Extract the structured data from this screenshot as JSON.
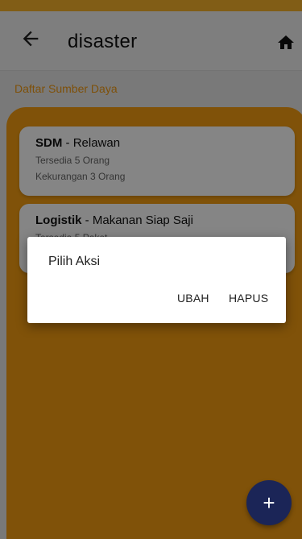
{
  "appbar": {
    "title": "disaster",
    "back_icon": "arrow-left-icon",
    "home_icon": "home-icon"
  },
  "section": {
    "title": "Daftar Sumber Daya"
  },
  "cards": [
    {
      "category": "SDM",
      "separator": " - ",
      "name": "Relawan",
      "line1": "Tersedia 5 Orang",
      "line2": "Kekurangan 3 Orang"
    },
    {
      "category": "Logistik",
      "separator": " - ",
      "name": "Makanan Siap Saji",
      "line1": "Tersedia 5 Paket"
    }
  ],
  "dialog": {
    "title": "Pilih Aksi",
    "edit_label": "UBAH",
    "delete_label": "HAPUS"
  },
  "fab": {
    "label": "+"
  },
  "colors": {
    "status_bar": "#f7b32b",
    "panel": "#f59e12",
    "accent_text": "#f19a12",
    "fab": "#1b2557"
  }
}
